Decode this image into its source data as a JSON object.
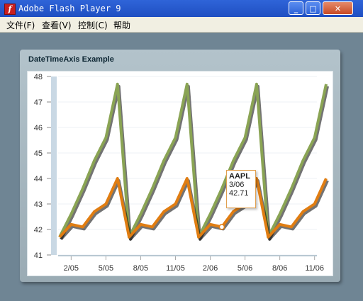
{
  "window": {
    "title": "Adobe Flash Player 9"
  },
  "menu": [
    "文件(F)",
    "查看(V)",
    "控制(C)",
    "帮助"
  ],
  "panel": {
    "title": "DateTimeAxis Example"
  },
  "tooltip": {
    "series": "AAPL",
    "date": "3/06",
    "value": "42.71"
  },
  "colors": {
    "high_series": "#8aa454",
    "low_series": "#e07d12",
    "titlebar": "#2a5fd6"
  },
  "chart_data": {
    "type": "line",
    "title": "DateTimeAxis Example",
    "x": [
      "1/05",
      "2/05",
      "3/05",
      "4/05",
      "5/05",
      "6/05",
      "7/05",
      "8/05",
      "9/05",
      "10/05",
      "11/05",
      "12/05",
      "1/06",
      "2/06",
      "3/06",
      "4/06",
      "5/06",
      "6/06",
      "7/06",
      "8/06",
      "9/06",
      "10/06",
      "11/06",
      "12/06"
    ],
    "x_tick_labels": [
      "2/05",
      "5/05",
      "8/05",
      "11/05",
      "2/06",
      "5/06",
      "8/06",
      "11/06"
    ],
    "ylim": [
      41,
      48
    ],
    "y_tick_labels": [
      "41",
      "42",
      "43",
      "44",
      "45",
      "46",
      "47",
      "48"
    ],
    "grid": true,
    "series": [
      {
        "values": [
          41.7,
          42.6,
          43.6,
          44.7,
          45.6,
          47.7,
          41.7,
          42.6,
          43.6,
          44.7,
          45.6,
          47.7,
          41.7,
          42.6,
          43.6,
          44.7,
          45.6,
          47.7,
          41.7,
          42.6,
          43.6,
          44.7,
          45.6,
          47.7
        ]
      },
      {
        "values": [
          41.7,
          42.2,
          42.1,
          42.7,
          43.0,
          44.0,
          41.7,
          42.2,
          42.1,
          42.7,
          43.0,
          44.0,
          41.7,
          42.2,
          42.1,
          42.71,
          43.0,
          44.0,
          41.7,
          42.2,
          42.1,
          42.7,
          43.0,
          44.0
        ]
      }
    ]
  }
}
